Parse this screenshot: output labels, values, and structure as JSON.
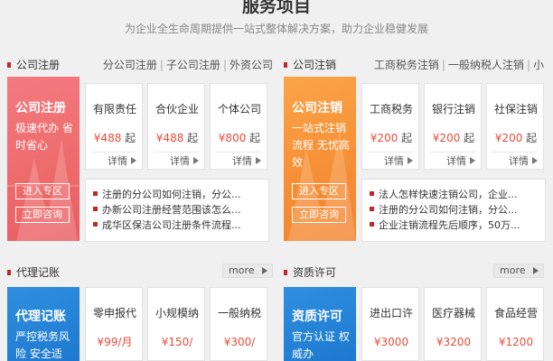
{
  "header": {
    "title": "服务项目",
    "subtitle": "为企业全生命周期提供一站式整体解决方案，助力企业稳健发展"
  },
  "company_registration": {
    "title": "公司注册",
    "links": [
      "分公司注册",
      "子公司注册",
      "外资公司"
    ],
    "banner": {
      "title": "公司注册",
      "desc": "极速代办 省时省心",
      "enter_label": "进入专区",
      "consult_label": "立即咨询",
      "color": "#ee6a6a"
    },
    "cards": [
      {
        "name": "有限责任",
        "price": "¥488",
        "unit": "起",
        "detail": "详情"
      },
      {
        "name": "合伙企业",
        "price": "¥488",
        "unit": "起",
        "detail": "详情"
      },
      {
        "name": "个体公司",
        "price": "¥800",
        "unit": "起",
        "detail": "详情"
      }
    ],
    "news": [
      "注册的分公司如何注销，分公...",
      "办新公司注册经营范围该怎么...",
      "成华区保洁公司注册条件流程..."
    ]
  },
  "company_deregistration": {
    "title": "公司注销",
    "links": [
      "工商税务注销",
      "一般纳税人注销",
      "小"
    ],
    "banner": {
      "title": "公司注销",
      "desc": "一站式注销 流程 无忧高效",
      "enter_label": "进入专区",
      "consult_label": "立即咨询",
      "color": "#f68e35"
    },
    "cards": [
      {
        "name": "工商税务",
        "price": "¥200",
        "unit": "起",
        "detail": "详情"
      },
      {
        "name": "银行注销",
        "price": "¥200",
        "unit": "起",
        "detail": "详情"
      },
      {
        "name": "社保注销",
        "price": "¥200",
        "unit": "起",
        "detail": "详情"
      }
    ],
    "news": [
      "法人怎样快速注销公司，企业...",
      "注册的分公司如何注销，分公...",
      "企业注销流程先后顺序，50万..."
    ]
  },
  "bookkeeping": {
    "title": "代理记账",
    "more_label": "more",
    "banner": {
      "title": "代理记账",
      "desc": "严控税务风险 安全适",
      "color": "#1e79cf"
    },
    "cards": [
      {
        "name": "零申报代",
        "price": "¥99/月"
      },
      {
        "name": "小规模纳",
        "price": "¥150/"
      },
      {
        "name": "一般纳税",
        "price": "¥300/"
      }
    ]
  },
  "qualification": {
    "title": "资质许可",
    "more_label": "more",
    "banner": {
      "title": "资质许可",
      "desc": "官方认证 权威办",
      "color": "#1e79cf"
    },
    "cards": [
      {
        "name": "进出口许",
        "price": "¥3000"
      },
      {
        "name": "医疗器械",
        "price": "¥3200"
      },
      {
        "name": "食品经营",
        "price": "¥1200"
      }
    ]
  }
}
